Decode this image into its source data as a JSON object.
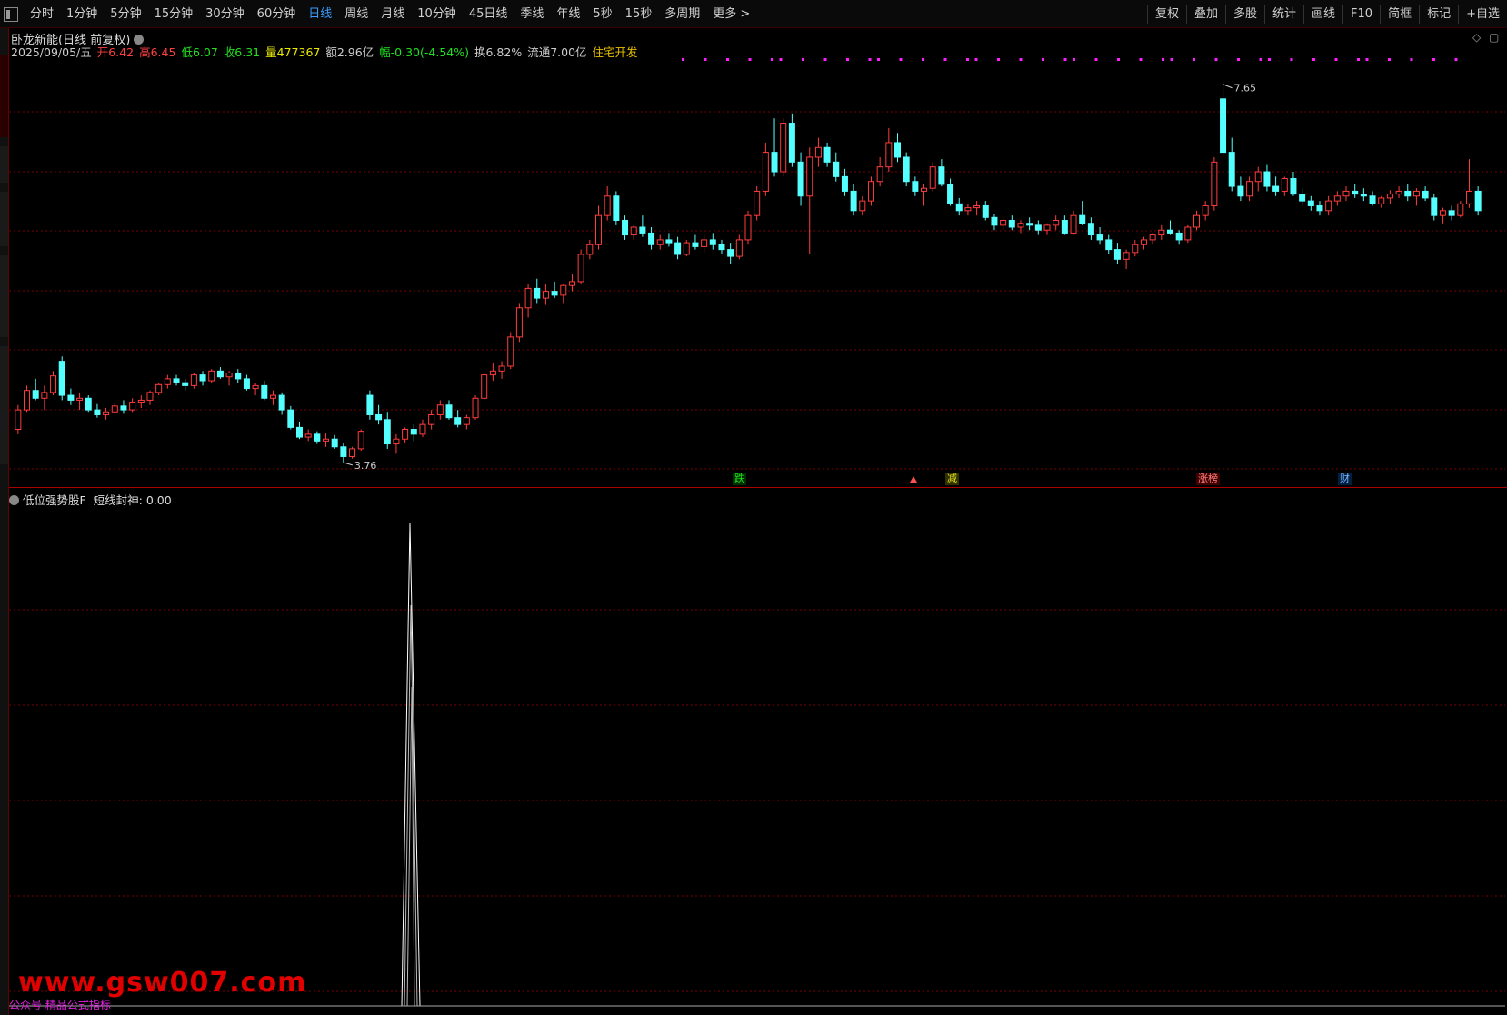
{
  "toolbar": {
    "periods": [
      "分时",
      "1分钟",
      "5分钟",
      "15分钟",
      "30分钟",
      "60分钟",
      "日线",
      "周线",
      "月线",
      "10分钟",
      "45日线",
      "季线",
      "年线",
      "5秒",
      "15秒",
      "多周期",
      "更多 >"
    ],
    "active_period": "日线",
    "right_items": [
      "复权",
      "叠加",
      "多股",
      "统计",
      "画线",
      "F10",
      "简框",
      "标记",
      "+自选"
    ]
  },
  "stock": {
    "title": "卧龙新能(日线 前复权)",
    "date": "2025/09/05/五",
    "open_label": "开",
    "open": "6.42",
    "high_label": "高",
    "high": "6.45",
    "low_label": "低",
    "low": "6.07",
    "close_label": "收",
    "close": "6.31",
    "vol_label": "量",
    "vol": "477367",
    "amount": "额2.96亿",
    "change": "幅-0.30(-4.54%)",
    "turnover": "换6.82%",
    "float_cap": "流通7.00亿",
    "sector": "住宅开发"
  },
  "colors": {
    "up": "#ff3c3c",
    "down": "#54ffff",
    "grid": "#7a0000",
    "magenta": "#ff20ff",
    "yellow": "#e8e800",
    "green": "#20e020"
  },
  "chart_data": {
    "type": "candlestick",
    "price_high_label": "7.65",
    "price_low_label": "3.76",
    "ylim": [
      3.6,
      7.9
    ],
    "candles": [
      [
        4.1,
        4.35,
        4.05,
        4.3
      ],
      [
        4.3,
        4.55,
        4.28,
        4.5
      ],
      [
        4.5,
        4.62,
        4.4,
        4.42
      ],
      [
        4.42,
        4.55,
        4.3,
        4.48
      ],
      [
        4.48,
        4.7,
        4.45,
        4.65
      ],
      [
        4.8,
        4.85,
        4.4,
        4.45
      ],
      [
        4.45,
        4.52,
        4.35,
        4.4
      ],
      [
        4.4,
        4.48,
        4.3,
        4.42
      ],
      [
        4.42,
        4.45,
        4.28,
        4.3
      ],
      [
        4.3,
        4.36,
        4.22,
        4.25
      ],
      [
        4.25,
        4.32,
        4.2,
        4.28
      ],
      [
        4.28,
        4.36,
        4.26,
        4.34
      ],
      [
        4.34,
        4.4,
        4.26,
        4.3
      ],
      [
        4.3,
        4.42,
        4.28,
        4.38
      ],
      [
        4.38,
        4.45,
        4.32,
        4.4
      ],
      [
        4.4,
        4.5,
        4.35,
        4.48
      ],
      [
        4.48,
        4.58,
        4.45,
        4.56
      ],
      [
        4.56,
        4.66,
        4.52,
        4.62
      ],
      [
        4.62,
        4.66,
        4.55,
        4.58
      ],
      [
        4.58,
        4.62,
        4.5,
        4.55
      ],
      [
        4.55,
        4.68,
        4.52,
        4.66
      ],
      [
        4.66,
        4.7,
        4.55,
        4.6
      ],
      [
        4.6,
        4.72,
        4.58,
        4.7
      ],
      [
        4.7,
        4.74,
        4.62,
        4.64
      ],
      [
        4.64,
        4.7,
        4.55,
        4.68
      ],
      [
        4.68,
        4.72,
        4.58,
        4.62
      ],
      [
        4.62,
        4.66,
        4.5,
        4.52
      ],
      [
        4.52,
        4.58,
        4.45,
        4.55
      ],
      [
        4.55,
        4.6,
        4.4,
        4.42
      ],
      [
        4.42,
        4.5,
        4.35,
        4.45
      ],
      [
        4.45,
        4.48,
        4.25,
        4.3
      ],
      [
        4.3,
        4.34,
        4.1,
        4.12
      ],
      [
        4.12,
        4.18,
        4.0,
        4.02
      ],
      [
        4.02,
        4.1,
        3.98,
        4.05
      ],
      [
        4.05,
        4.08,
        3.95,
        3.98
      ],
      [
        3.98,
        4.06,
        3.92,
        4.0
      ],
      [
        4.0,
        4.04,
        3.9,
        3.92
      ],
      [
        3.92,
        3.96,
        3.76,
        3.82
      ],
      [
        3.82,
        3.92,
        3.8,
        3.9
      ],
      [
        3.9,
        4.1,
        3.88,
        4.08
      ],
      [
        4.45,
        4.5,
        4.2,
        4.25
      ],
      [
        4.25,
        4.35,
        4.15,
        4.2
      ],
      [
        4.2,
        4.28,
        3.9,
        3.95
      ],
      [
        3.95,
        4.05,
        3.85,
        4.0
      ],
      [
        4.0,
        4.12,
        3.96,
        4.1
      ],
      [
        4.1,
        4.15,
        3.98,
        4.05
      ],
      [
        4.05,
        4.2,
        4.02,
        4.15
      ],
      [
        4.15,
        4.3,
        4.1,
        4.25
      ],
      [
        4.25,
        4.4,
        4.2,
        4.35
      ],
      [
        4.35,
        4.4,
        4.2,
        4.22
      ],
      [
        4.22,
        4.3,
        4.12,
        4.15
      ],
      [
        4.15,
        4.25,
        4.1,
        4.22
      ],
      [
        4.22,
        4.45,
        4.2,
        4.42
      ],
      [
        4.42,
        4.68,
        4.4,
        4.66
      ],
      [
        4.66,
        4.78,
        4.6,
        4.7
      ],
      [
        4.7,
        4.8,
        4.62,
        4.75
      ],
      [
        4.75,
        5.1,
        4.72,
        5.05
      ],
      [
        5.05,
        5.4,
        5.0,
        5.35
      ],
      [
        5.35,
        5.6,
        5.25,
        5.55
      ],
      [
        5.55,
        5.65,
        5.4,
        5.45
      ],
      [
        5.45,
        5.6,
        5.38,
        5.52
      ],
      [
        5.52,
        5.62,
        5.45,
        5.48
      ],
      [
        5.48,
        5.6,
        5.4,
        5.58
      ],
      [
        5.58,
        5.7,
        5.52,
        5.62
      ],
      [
        5.62,
        5.95,
        5.6,
        5.9
      ],
      [
        5.9,
        6.05,
        5.85,
        6.0
      ],
      [
        6.0,
        6.4,
        5.95,
        6.3
      ],
      [
        6.3,
        6.6,
        6.25,
        6.5
      ],
      [
        6.5,
        6.55,
        6.2,
        6.25
      ],
      [
        6.25,
        6.3,
        6.05,
        6.1
      ],
      [
        6.1,
        6.2,
        6.05,
        6.18
      ],
      [
        6.18,
        6.3,
        6.08,
        6.12
      ],
      [
        6.12,
        6.18,
        5.95,
        6.0
      ],
      [
        6.0,
        6.1,
        5.95,
        6.05
      ],
      [
        6.05,
        6.12,
        5.98,
        6.02
      ],
      [
        6.02,
        6.08,
        5.85,
        5.9
      ],
      [
        5.9,
        6.05,
        5.88,
        6.02
      ],
      [
        6.02,
        6.1,
        5.95,
        5.98
      ],
      [
        5.98,
        6.1,
        5.92,
        6.05
      ],
      [
        6.05,
        6.12,
        5.95,
        6.0
      ],
      [
        6.0,
        6.05,
        5.9,
        5.95
      ],
      [
        5.95,
        6.02,
        5.8,
        5.88
      ],
      [
        5.88,
        6.1,
        5.85,
        6.05
      ],
      [
        6.05,
        6.35,
        6.0,
        6.3
      ],
      [
        6.3,
        6.6,
        6.25,
        6.55
      ],
      [
        6.55,
        7.05,
        6.5,
        6.95
      ],
      [
        6.95,
        7.3,
        6.7,
        6.75
      ],
      [
        6.75,
        7.3,
        6.7,
        7.25
      ],
      [
        7.25,
        7.35,
        6.8,
        6.85
      ],
      [
        6.85,
        6.95,
        6.4,
        6.5
      ],
      [
        6.5,
        7.0,
        5.9,
        6.9
      ],
      [
        6.9,
        7.1,
        6.8,
        7.0
      ],
      [
        7.0,
        7.05,
        6.8,
        6.85
      ],
      [
        6.85,
        6.95,
        6.65,
        6.7
      ],
      [
        6.7,
        6.78,
        6.5,
        6.55
      ],
      [
        6.55,
        6.62,
        6.3,
        6.35
      ],
      [
        6.35,
        6.5,
        6.3,
        6.45
      ],
      [
        6.45,
        6.7,
        6.4,
        6.65
      ],
      [
        6.65,
        6.9,
        6.6,
        6.8
      ],
      [
        6.8,
        7.2,
        6.75,
        7.05
      ],
      [
        7.05,
        7.15,
        6.85,
        6.9
      ],
      [
        6.9,
        6.95,
        6.6,
        6.65
      ],
      [
        6.65,
        6.7,
        6.5,
        6.55
      ],
      [
        6.55,
        6.62,
        6.4,
        6.58
      ],
      [
        6.58,
        6.85,
        6.55,
        6.8
      ],
      [
        6.8,
        6.88,
        6.6,
        6.62
      ],
      [
        6.62,
        6.68,
        6.4,
        6.42
      ],
      [
        6.42,
        6.48,
        6.3,
        6.35
      ],
      [
        6.35,
        6.42,
        6.3,
        6.38
      ],
      [
        6.38,
        6.45,
        6.3,
        6.4
      ],
      [
        6.4,
        6.45,
        6.25,
        6.28
      ],
      [
        6.28,
        6.32,
        6.15,
        6.2
      ],
      [
        6.2,
        6.28,
        6.15,
        6.25
      ],
      [
        6.25,
        6.3,
        6.15,
        6.18
      ],
      [
        6.18,
        6.25,
        6.12,
        6.22
      ],
      [
        6.22,
        6.28,
        6.15,
        6.2
      ],
      [
        6.2,
        6.25,
        6.1,
        6.15
      ],
      [
        6.15,
        6.22,
        6.1,
        6.2
      ],
      [
        6.2,
        6.3,
        6.15,
        6.25
      ],
      [
        6.25,
        6.3,
        6.1,
        6.12
      ],
      [
        6.12,
        6.35,
        6.1,
        6.3
      ],
      [
        6.3,
        6.45,
        6.2,
        6.22
      ],
      [
        6.22,
        6.28,
        6.05,
        6.1
      ],
      [
        6.1,
        6.18,
        6.0,
        6.05
      ],
      [
        6.05,
        6.1,
        5.9,
        5.95
      ],
      [
        5.95,
        6.02,
        5.8,
        5.85
      ],
      [
        5.85,
        5.95,
        5.75,
        5.92
      ],
      [
        5.92,
        6.05,
        5.88,
        6.0
      ],
      [
        6.0,
        6.08,
        5.95,
        6.05
      ],
      [
        6.05,
        6.12,
        6.0,
        6.1
      ],
      [
        6.1,
        6.2,
        6.05,
        6.15
      ],
      [
        6.15,
        6.25,
        6.1,
        6.12
      ],
      [
        6.12,
        6.15,
        6.0,
        6.05
      ],
      [
        6.05,
        6.2,
        6.02,
        6.18
      ],
      [
        6.18,
        6.35,
        6.15,
        6.3
      ],
      [
        6.3,
        6.45,
        6.25,
        6.4
      ],
      [
        6.4,
        6.9,
        6.35,
        6.85
      ],
      [
        7.5,
        7.65,
        6.9,
        6.95
      ],
      [
        6.95,
        7.1,
        6.55,
        6.6
      ],
      [
        6.6,
        6.7,
        6.45,
        6.5
      ],
      [
        6.5,
        6.7,
        6.45,
        6.65
      ],
      [
        6.65,
        6.8,
        6.55,
        6.75
      ],
      [
        6.75,
        6.82,
        6.55,
        6.6
      ],
      [
        6.6,
        6.7,
        6.5,
        6.55
      ],
      [
        6.55,
        6.7,
        6.5,
        6.68
      ],
      [
        6.68,
        6.75,
        6.5,
        6.52
      ],
      [
        6.52,
        6.58,
        6.4,
        6.45
      ],
      [
        6.45,
        6.5,
        6.35,
        6.4
      ],
      [
        6.4,
        6.45,
        6.3,
        6.35
      ],
      [
        6.35,
        6.5,
        6.3,
        6.45
      ],
      [
        6.45,
        6.55,
        6.4,
        6.5
      ],
      [
        6.5,
        6.6,
        6.45,
        6.55
      ],
      [
        6.55,
        6.62,
        6.48,
        6.52
      ],
      [
        6.52,
        6.58,
        6.45,
        6.5
      ],
      [
        6.5,
        6.55,
        6.4,
        6.42
      ],
      [
        6.42,
        6.5,
        6.38,
        6.48
      ],
      [
        6.48,
        6.56,
        6.42,
        6.52
      ],
      [
        6.52,
        6.6,
        6.48,
        6.55
      ],
      [
        6.55,
        6.62,
        6.45,
        6.5
      ],
      [
        6.5,
        6.58,
        6.4,
        6.55
      ],
      [
        6.55,
        6.6,
        6.45,
        6.48
      ],
      [
        6.48,
        6.52,
        6.25,
        6.3
      ],
      [
        6.3,
        6.38,
        6.22,
        6.35
      ],
      [
        6.35,
        6.4,
        6.25,
        6.3
      ],
      [
        6.3,
        6.45,
        6.28,
        6.42
      ],
      [
        6.42,
        6.88,
        6.38,
        6.55
      ],
      [
        6.55,
        6.6,
        6.3,
        6.35
      ]
    ]
  },
  "markers": {
    "magenta_dots_count": 40
  },
  "events": [
    {
      "label": "跌",
      "color": "#20e020",
      "bg": "#003000"
    },
    {
      "label": "减",
      "color": "#e0e020",
      "bg": "#303000"
    },
    {
      "label": "涨榜",
      "color": "#ff8080",
      "bg": "#400000"
    },
    {
      "label": "财",
      "color": "#80b0ff",
      "bg": "#002040"
    }
  ],
  "subchart": {
    "title": "低位强势股F",
    "indicator": "短线封神: 0.00"
  },
  "watermark": {
    "url": "www.gsw007.com",
    "caption": "公众号 精品公式指标"
  }
}
